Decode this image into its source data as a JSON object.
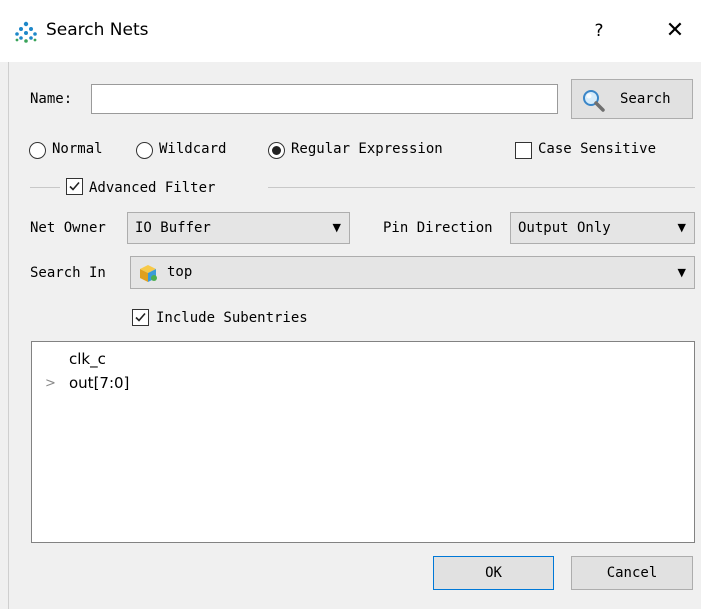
{
  "dialog": {
    "title": "Search Nets",
    "help": "?",
    "close": "✕"
  },
  "name_row": {
    "label": "Name:",
    "value": "",
    "search_button": "Search"
  },
  "match_modes": {
    "options": [
      "Normal",
      "Wildcard",
      "Regular Expression"
    ],
    "selected": "Regular Expression",
    "case_sensitive_label": "Case Sensitive",
    "case_sensitive_checked": false
  },
  "advanced_filter": {
    "label": "Advanced Filter",
    "checked": true,
    "net_owner_label": "Net Owner",
    "net_owner_value": "IO Buffer",
    "pin_direction_label": "Pin Direction",
    "pin_direction_value": "Output Only",
    "search_in_label": "Search In",
    "search_in_value": "top",
    "include_subentries_label": "Include Subentries",
    "include_subentries_checked": true
  },
  "results": [
    {
      "label": "clk_c",
      "expandable": false
    },
    {
      "label": "out[7:0]",
      "expandable": true
    }
  ],
  "footer": {
    "ok": "OK",
    "cancel": "Cancel"
  },
  "colors": {
    "accent": "#0078d7",
    "background": "#f0f0f0"
  }
}
